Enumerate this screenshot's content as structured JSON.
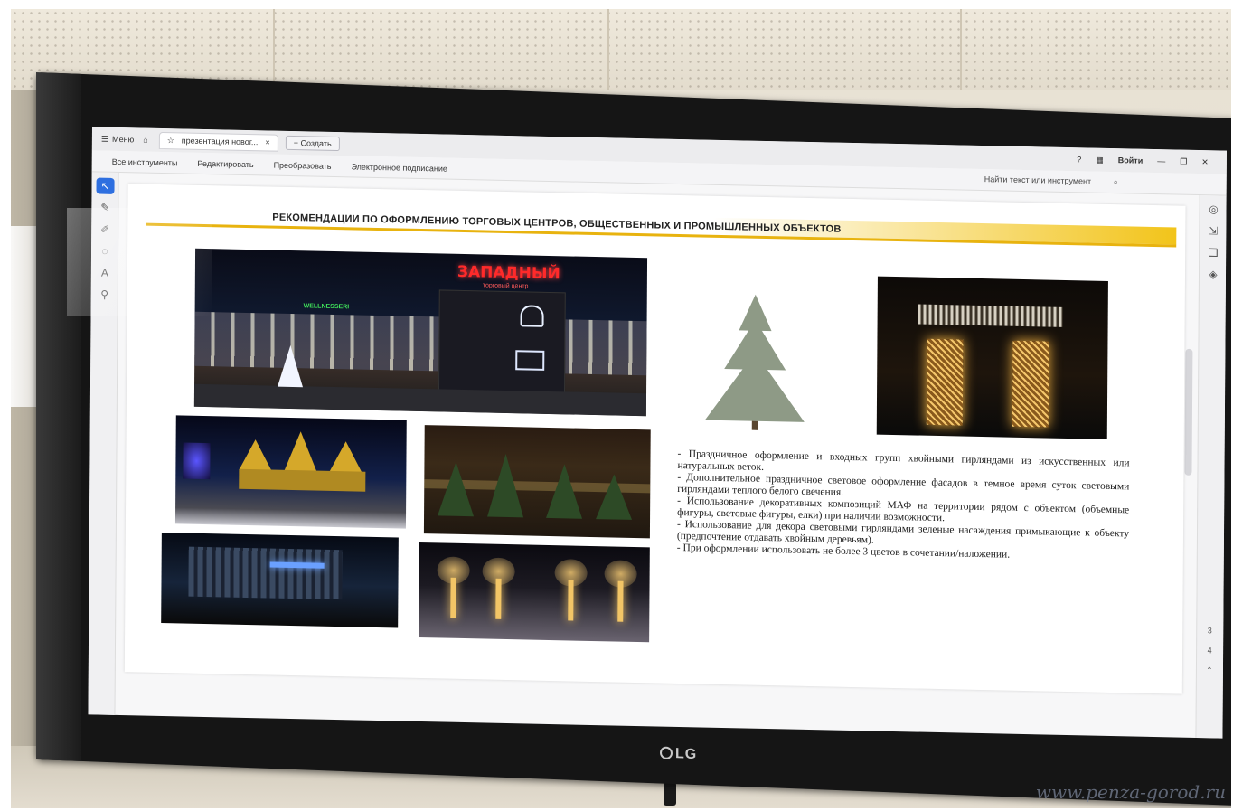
{
  "app": {
    "menu_label": "Меню",
    "tab_title": "презентация новог...",
    "tab_close": "×",
    "create_label": "+ Создать",
    "signin_label": "Войти",
    "help_icon": "?",
    "window_min": "—",
    "window_max": "❐",
    "window_close": "✕"
  },
  "menubar": {
    "items": [
      "Все инструменты",
      "Редактировать",
      "Преобразовать",
      "Электронное подписание"
    ],
    "search_placeholder": "Найти текст или инструмент"
  },
  "pages": [
    "3",
    "4"
  ],
  "slide": {
    "title": "РЕКОМЕНДАЦИИ ПО ОФОРМЛЕНИЮ ТОРГОВЫХ ЦЕНТРОВ, ОБЩЕСТВЕННЫХ И ПРОМЫШЛЕННЫХ ОБЪЕКТОВ",
    "mall_sign": "ЗАПАДНЫЙ",
    "mall_sub": "торговый центр",
    "mall_store": "WELLNESSERI",
    "bullets": [
      "- Праздничное оформление и входных групп хвойными гирляндами из искусственных или натуральных веток.",
      "- Дополнительное праздничное световое оформление фасадов в темное время суток световыми гирляндами теплого белого свечения.",
      "- Использование декоративных композиций МАФ на территории рядом с объектом (объемные фигуры, световые фигуры, елки) при наличии возможности.",
      "- Использование для декора световыми гирляндами зеленые насаждения примыкающие к объекту (предпочтение отдавать хвойным деревьям).",
      "- При оформлении использовать не более 3 цветов в сочетании/наложении."
    ]
  },
  "tv": {
    "brand": "LG"
  },
  "watermark": "www.penza-gorod.ru"
}
